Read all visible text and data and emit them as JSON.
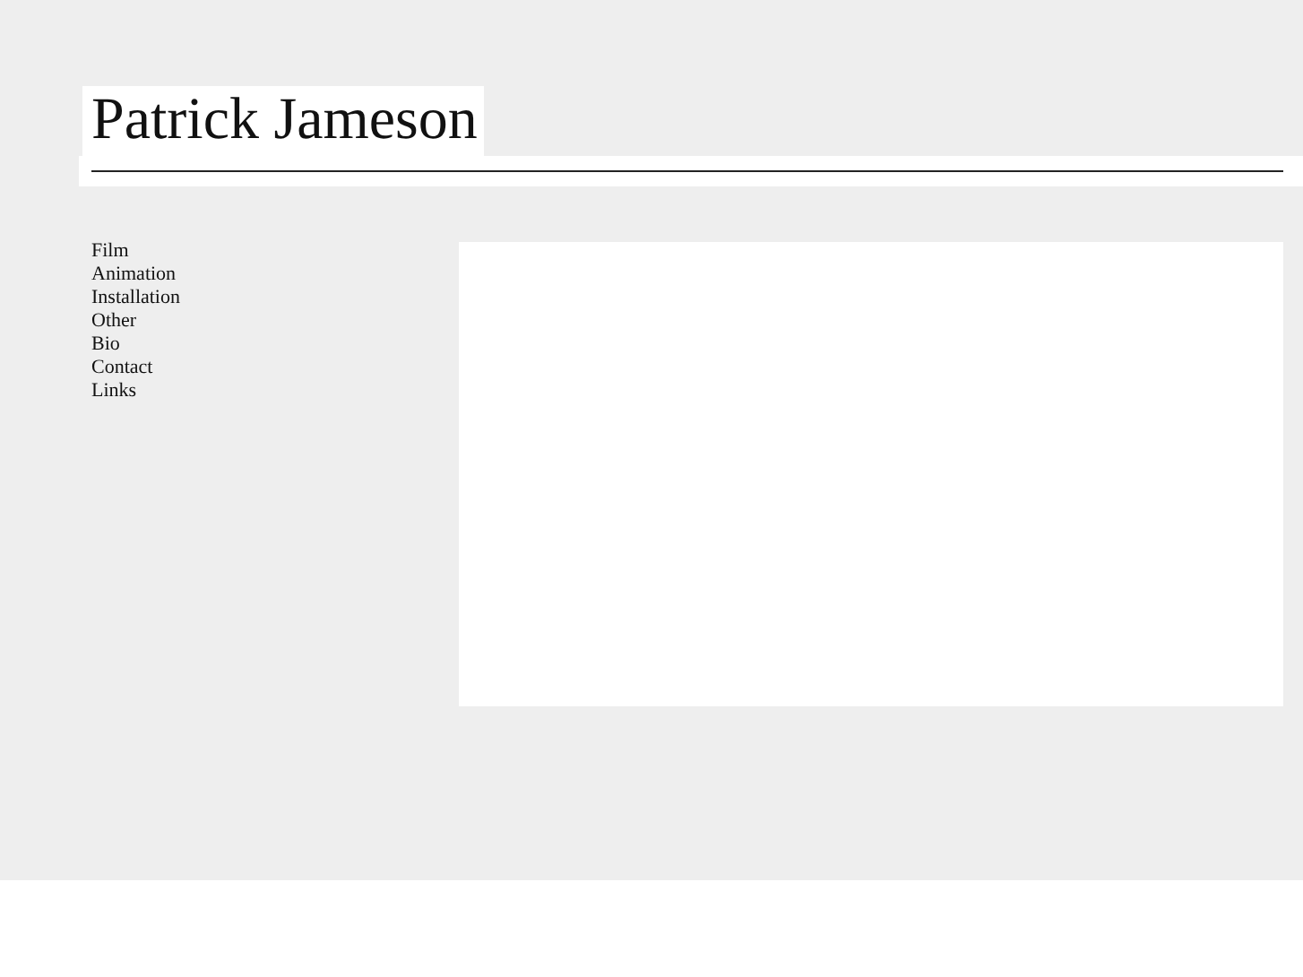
{
  "site_title": "Patrick Jameson",
  "nav": [
    {
      "label": "Film"
    },
    {
      "label": "Animation"
    },
    {
      "label": "Installation"
    },
    {
      "label": "Other"
    },
    {
      "label": "Bio"
    },
    {
      "label": "Contact"
    },
    {
      "label": "Links"
    }
  ]
}
